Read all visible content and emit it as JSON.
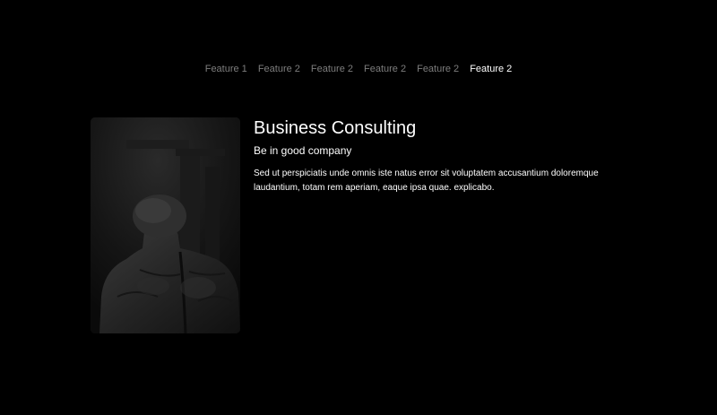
{
  "tabs": [
    {
      "label": "Feature 1",
      "active": false
    },
    {
      "label": "Feature 2",
      "active": false
    },
    {
      "label": "Feature 2",
      "active": false
    },
    {
      "label": "Feature 2",
      "active": false
    },
    {
      "label": "Feature 2",
      "active": false
    },
    {
      "label": "Feature 2",
      "active": true
    }
  ],
  "feature": {
    "title": "Business Consulting",
    "subtitle": "Be in good company",
    "description": "Sed ut perspiciatis unde omnis iste natus error sit voluptatem accusantium doloremque laudantium, totam rem aperiam, eaque ipsa quae. explicabo.",
    "image_icon": "statue-back-photo"
  },
  "colors": {
    "background": "#000000",
    "text": "#ffffff",
    "tab_inactive": "#7d7d7d",
    "tab_active": "#ffffff"
  }
}
